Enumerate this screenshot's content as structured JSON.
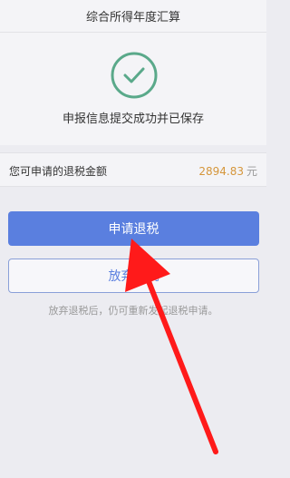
{
  "header": {
    "title": "综合所得年度汇算"
  },
  "success": {
    "message": "申报信息提交成功并已保存"
  },
  "refund": {
    "label": "您可申请的退税金额",
    "amount": "2894.83",
    "unit": "元"
  },
  "buttons": {
    "apply": "申请退税",
    "abandon": "放弃退税"
  },
  "hint": "放弃退税后，仍可重新发起退税申请。",
  "colors": {
    "primary": "#5a7fdf",
    "success": "#5aa98a",
    "amount": "#d5963b",
    "annotation_arrow": "#ff1a1a"
  },
  "icons": {
    "success": "check-circle-icon",
    "annotation": "red-arrow-annotation"
  }
}
